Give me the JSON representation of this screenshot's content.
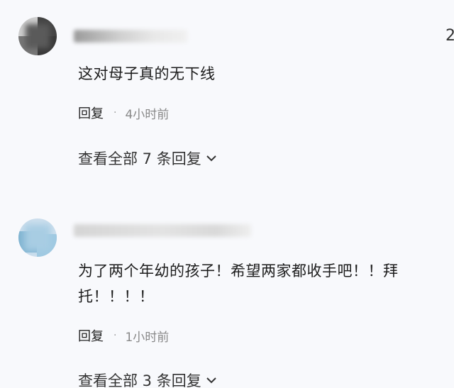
{
  "comments": [
    {
      "text": "这对母子真的无下线",
      "reply_label": "回复",
      "separator": "·",
      "time": "4小时前",
      "view_replies": "查看全部 7 条回复",
      "edge_count": "2"
    },
    {
      "text_line1": "为了两个年幼的孩子！希望两家都收手吧！！拜",
      "text_line2": "托！！！！",
      "reply_label": "回复",
      "separator": "·",
      "time": "1小时前",
      "view_replies": "查看全部 3 条回复"
    }
  ],
  "icons": {
    "expand": "chevron-down-icon"
  }
}
